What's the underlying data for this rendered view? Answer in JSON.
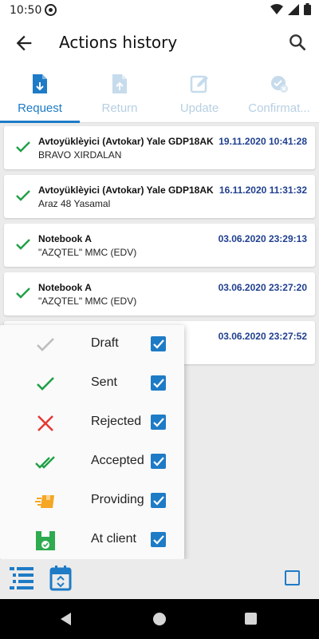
{
  "status_bar": {
    "time": "10:50"
  },
  "header": {
    "title": "Actions history"
  },
  "tabs": [
    {
      "label": "Request",
      "icon": "document-download-icon",
      "active": true
    },
    {
      "label": "Return",
      "icon": "document-upload-icon",
      "active": false
    },
    {
      "label": "Update",
      "icon": "edit-icon",
      "active": false
    },
    {
      "label": "Confirmat...",
      "icon": "confirm-badge-icon",
      "active": false
    }
  ],
  "items": [
    {
      "name": "Avtoyüklèyici (Avtokar) Yale GDP18AK",
      "location": "BRAVO XIRDALAN",
      "date": "19.11.2020 10:41:28",
      "status": "sent"
    },
    {
      "name": "Avtoyüklèyici (Avtokar) Yale GDP18AK",
      "location": "Araz 48 Yasamal",
      "date": "16.11.2020 11:31:32",
      "status": "sent"
    },
    {
      "name": "Notebook A",
      "location": " \"AZQTEL\" MMC (EDV)",
      "date": "03.06.2020 23:29:13",
      "status": "sent"
    },
    {
      "name": "Notebook A",
      "location": " \"AZQTEL\" MMC (EDV)",
      "date": "03.06.2020 23:27:20",
      "status": "sent"
    },
    {
      "name": "",
      "location": "",
      "date": "03.06.2020 23:27:52",
      "status": "sent"
    }
  ],
  "filters": [
    {
      "label": "Draft",
      "icon": "check-gray-icon",
      "checked": true
    },
    {
      "label": "Sent",
      "icon": "check-green-icon",
      "checked": true
    },
    {
      "label": "Rejected",
      "icon": "cross-red-icon",
      "checked": true
    },
    {
      "label": "Accepted",
      "icon": "double-check-icon",
      "checked": true
    },
    {
      "label": "Providing",
      "icon": "delivery-box-icon",
      "checked": true
    },
    {
      "label": "At client",
      "icon": "client-box-icon",
      "checked": true
    }
  ],
  "colors": {
    "accent": "#1e7bc6",
    "date": "#1f3f8f",
    "green": "#1fa046",
    "red": "#e53935",
    "orange": "#f5a623"
  }
}
